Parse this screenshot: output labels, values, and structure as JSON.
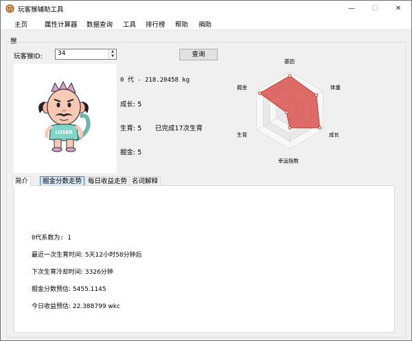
{
  "window": {
    "title": "玩客猴辅助工具",
    "controls": {
      "minimize": "—",
      "maximize": "☐",
      "close": "✕"
    }
  },
  "menu": [
    "主页",
    "属性计算器",
    "数据查询",
    "工具",
    "排行榜",
    "帮助",
    "捐助"
  ],
  "group_title": "猴",
  "query": {
    "id_label": "玩客猴ID:",
    "id_value": "34",
    "button_label": "查询"
  },
  "monkey": {
    "generation_weight": "0 代 - 218.20458 kg",
    "growth": "成长: 5",
    "breed": "生育: 5",
    "breed_count": "已完成17次生育",
    "gold": "掘金: 5",
    "shirt_text": "LOSER"
  },
  "radar": {
    "labels": [
      "基因",
      "体重",
      "成长",
      "幸运指数",
      "生育",
      "掘金"
    ],
    "values": [
      0.9,
      0.8,
      0.9,
      0.45,
      0.1,
      0.9
    ],
    "fill_color": "#d9534f",
    "stroke_color": "#c0392b"
  },
  "tabs": [
    {
      "label": "简介",
      "state": "active"
    },
    {
      "label": "掘金分数走势",
      "state": "hover"
    },
    {
      "label": "每日收益走势",
      "state": "normal"
    },
    {
      "label": "名词解释",
      "state": "normal"
    }
  ],
  "intro": {
    "coefficient": "0代系数为: 1",
    "last_breed": "最近一次生育时间: 5天12小时58分钟后",
    "cooldown": "下次生育冷却时间: 3326分钟",
    "gold_score": "掘金分数预估: 5455.1145",
    "today_income": "今日收益预估: 22.388799 wkc"
  }
}
